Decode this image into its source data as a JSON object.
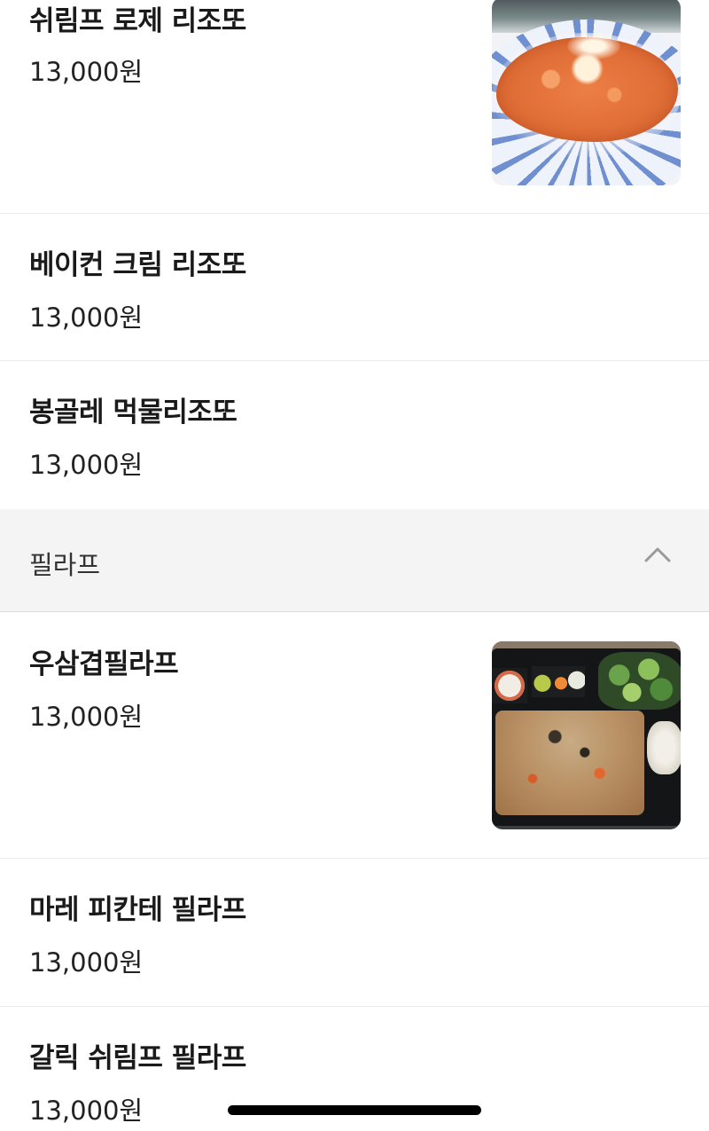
{
  "menu_items_top": [
    {
      "name": "쉬림프 로제 리조또",
      "price": "13,000원",
      "image": "shrimp-rose-risotto-photo"
    },
    {
      "name": "베이컨 크림 리조또",
      "price": "13,000원"
    },
    {
      "name": "봉골레 먹물리조또",
      "price": "13,000원"
    }
  ],
  "category": {
    "title": "필라프",
    "state_icon": "chevron-up-icon"
  },
  "menu_items_pilaf": [
    {
      "name": "우삼겹필라프",
      "price": "13,000원",
      "image": "beef-brisket-pilaf-photo"
    },
    {
      "name": "마레 피칸테 필라프",
      "price": "13,000원"
    },
    {
      "name": "갈릭 쉬림프 필라프",
      "price": "13,000원"
    }
  ],
  "colors": {
    "section_bg": "#f4f4f4",
    "divider": "#ececec",
    "text": "#1a1a1a"
  }
}
